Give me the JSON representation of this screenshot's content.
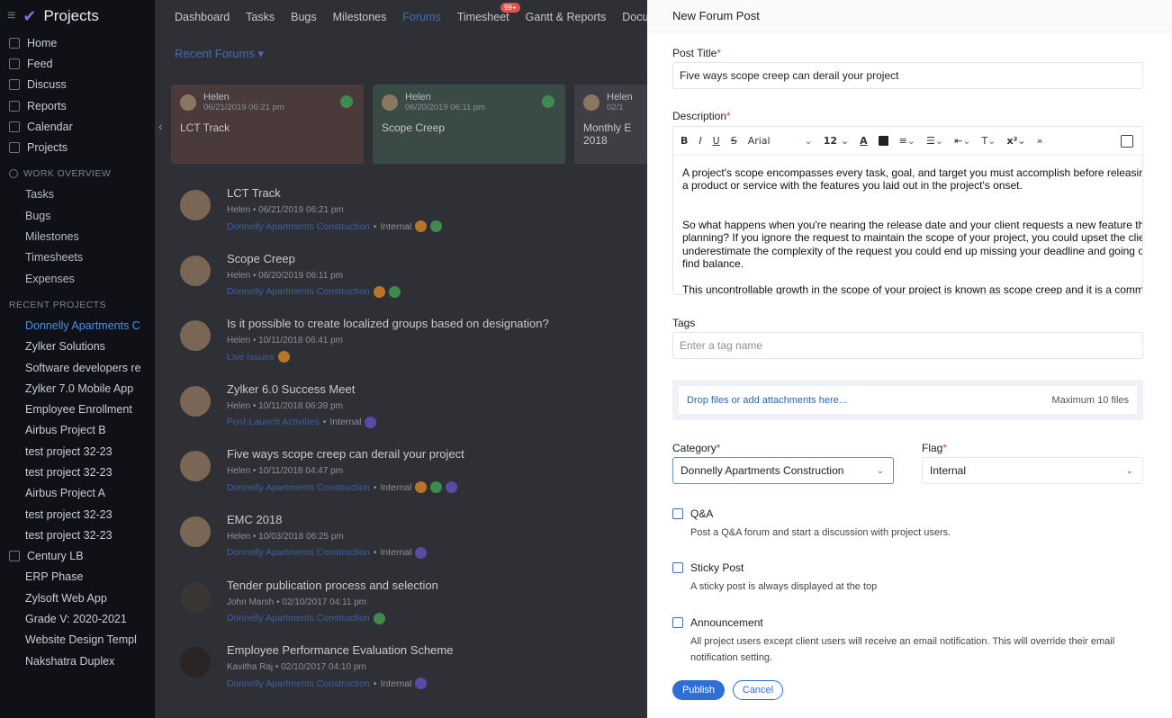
{
  "sidebar": {
    "app_title": "Projects",
    "nav": [
      {
        "label": "Home",
        "icon": "home-icon"
      },
      {
        "label": "Feed",
        "icon": "feed-icon"
      },
      {
        "label": "Discuss",
        "icon": "discuss-icon"
      },
      {
        "label": "Reports",
        "icon": "reports-icon"
      },
      {
        "label": "Calendar",
        "icon": "calendar-icon"
      },
      {
        "label": "Projects",
        "icon": "projects-icon"
      }
    ],
    "work_overview_title": "WORK OVERVIEW",
    "work_overview": [
      "Tasks",
      "Bugs",
      "Milestones",
      "Timesheets",
      "Expenses"
    ],
    "recent_projects_title": "RECENT PROJECTS",
    "recent_projects": [
      "Donnelly Apartments C",
      "Zylker Solutions",
      "Software developers re",
      "Zylker 7.0 Mobile App",
      "Employee Enrollment",
      "Airbus Project B",
      "test project 32-23",
      "test project 32-23",
      "Airbus Project A",
      "test project 32-23",
      "test project 32-23"
    ],
    "portfolio": "Century LB",
    "portfolio_projects": [
      "ERP Phase",
      "Zylsoft Web App",
      "Grade V: 2020-2021",
      "Website Design Templ",
      "Nakshatra Duplex"
    ]
  },
  "topnav": {
    "tabs": [
      "Dashboard",
      "Tasks",
      "Bugs",
      "Milestones",
      "Forums",
      "Timesheet",
      "Gantt & Reports",
      "Document"
    ],
    "active": "Forums",
    "timesheet_badge": "99+"
  },
  "forums": {
    "recent_label": "Recent Forums ▾",
    "cards": [
      {
        "author": "Helen",
        "date": "06/21/2019 06:21 pm",
        "title": "LCT Track",
        "bg": "#4a3a3a"
      },
      {
        "author": "Helen",
        "date": "06/20/2019 06:11 pm",
        "title": "Scope Creep",
        "bg": "#3a4a44"
      },
      {
        "author": "Helen",
        "date": "02/1",
        "title": "Monthly E\n2018",
        "bg": "#3d3f44"
      }
    ],
    "posts": [
      {
        "title": "LCT Track",
        "meta": "Helen  •  06/21/2019 06:21 pm",
        "project": "Donnelly Apartments Construction",
        "flag": "Internal",
        "chips": [
          "#b8752a",
          "#3f8a4f"
        ],
        "avatar": "#7a6655"
      },
      {
        "title": "Scope Creep",
        "meta": "Helen  •  06/20/2019 06:11 pm",
        "project": "Donnelly Apartments Construction",
        "flag": "",
        "chips": [
          "#b8752a",
          "#3f8a4f"
        ],
        "avatar": "#7a6655"
      },
      {
        "title": "Is it possible to create localized groups based on designation?",
        "meta": "Helen  •  10/11/2018 06:41 pm",
        "project": "Live Issues",
        "flag": "",
        "chips": [
          "#b8752a"
        ],
        "avatar": "#7a6655"
      },
      {
        "title": "Zylker 6.0 Success Meet",
        "meta": "Helen  •  10/11/2018 06:39 pm",
        "project": "Post-Launch Activities",
        "flag": "Internal",
        "chips": [
          "#5a4aa8"
        ],
        "avatar": "#7a6655"
      },
      {
        "title": "Five ways scope creep can derail your project",
        "meta": "Helen  •  10/11/2018 04:47 pm",
        "project": "Donnelly Apartments Construction",
        "flag": "Internal",
        "chips": [
          "#b8752a",
          "#3f8a4f",
          "#5a4aa8"
        ],
        "avatar": "#7a6655"
      },
      {
        "title": "EMC 2018",
        "meta": "Helen  •  10/03/2018 06:25 pm",
        "project": "Donnelly Apartments Construction",
        "flag": "Internal",
        "chips": [
          "#5a4aa8"
        ],
        "avatar": "#7a6655"
      },
      {
        "title": "Tender publication process and selection",
        "meta": "John Marsh  •  02/10/2017 04:11 pm",
        "project": "Donnelly Apartments Construction",
        "flag": "",
        "chips": [
          "#3f8a4f"
        ],
        "avatar": "#3a3633"
      },
      {
        "title": "Employee Performance Evaluation Scheme",
        "meta": "Kavitha Raj  •  02/10/2017 04:10 pm",
        "project": "Donnelly Apartments Construction",
        "flag": "Internal",
        "chips": [
          "#5a4aa8"
        ],
        "avatar": "#2a2524"
      }
    ]
  },
  "panel": {
    "heading": "New Forum Post",
    "post_title_label": "Post Title",
    "post_title_value": "Five ways scope creep can derail your project",
    "description_label": "Description",
    "toolbar": {
      "bold": "B",
      "italic": "I",
      "underline": "U",
      "strike": "S",
      "font": "Arial",
      "size": "12",
      "text_color": "A",
      "superscript": "x²",
      "more": "»"
    },
    "description_paragraphs": [
      "A project's scope encompasses every task, goal, and target you must accomplish before releasing\na product or service with the features you laid out in the project's onset.",
      "So what happens when you're nearing the release date and your client requests a new feature that wa\nplanning? If you ignore the request to maintain the scope of your project, you could upset the client. Bu\nunderestimate the complexity of the request you could end up missing your deadline and going over bu\nfind balance.",
      "This uncontrollable growth in the scope of your project is known as scope creep and it is a common pro"
    ],
    "tags_label": "Tags",
    "tags_placeholder": "Enter a tag name",
    "drop_text": "Drop files or add attachments here...",
    "drop_max": "Maximum 10 files",
    "category_label": "Category",
    "category_value": "Donnelly Apartments Construction",
    "flag_label": "Flag",
    "flag_value": "Internal",
    "options": [
      {
        "label": "Q&A",
        "desc": "Post a Q&A forum and start a discussion with project users."
      },
      {
        "label": "Sticky Post",
        "desc": "A sticky post is always displayed at the top"
      },
      {
        "label": "Announcement",
        "desc": "All project users except client users will receive an email notification. This will override their email notification setting."
      }
    ],
    "publish_label": "Publish",
    "cancel_label": "Cancel"
  }
}
